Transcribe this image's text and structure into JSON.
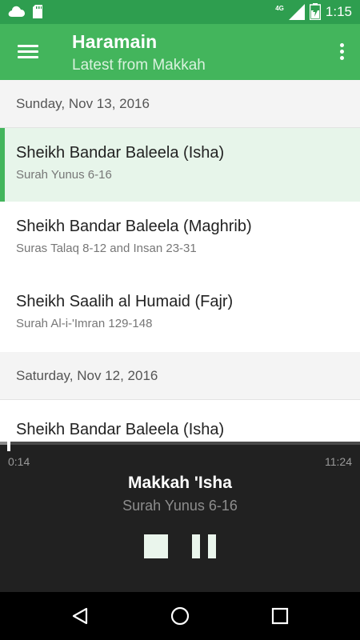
{
  "status_bar": {
    "network_label": "4G",
    "time": "1:15",
    "icons": [
      "cloud-icon",
      "sd-card-icon",
      "signal-icon",
      "battery-icon"
    ]
  },
  "app_bar": {
    "title": "Haramain",
    "subtitle": "Latest from Makkah",
    "icons": [
      "menu-icon",
      "more-vert-icon"
    ]
  },
  "list": {
    "groups": [
      {
        "date": "Sunday, Nov 13, 2016",
        "items": [
          {
            "title": "Sheikh Bandar Baleela (Isha)",
            "subtitle": "Surah Yunus 6-16",
            "selected": true
          },
          {
            "title": "Sheikh Bandar Baleela (Maghrib)",
            "subtitle": "Suras Talaq 8-12 and Insan 23-31"
          },
          {
            "title": "Sheikh Saalih al Humaid (Fajr)",
            "subtitle": "Surah Al-i-'Imran 129-148"
          }
        ]
      },
      {
        "date": "Saturday, Nov 12, 2016",
        "items": [
          {
            "title": "Sheikh Bandar Baleela (Isha)"
          }
        ]
      }
    ]
  },
  "player": {
    "elapsed": "0:14",
    "total": "11:24",
    "progress_fraction": 0.0205,
    "title": "Makkah 'Isha",
    "subtitle": "Surah Yunus 6-16",
    "controls": [
      "stop-icon",
      "pause-icon"
    ]
  },
  "nav_bar": {
    "icons": [
      "back-icon",
      "home-icon",
      "recents-icon"
    ]
  },
  "colors": {
    "status_bar": "#2e9e4f",
    "primary": "#43b55c",
    "selected_row": "#e7f5ea",
    "player_bg": "#212121"
  }
}
